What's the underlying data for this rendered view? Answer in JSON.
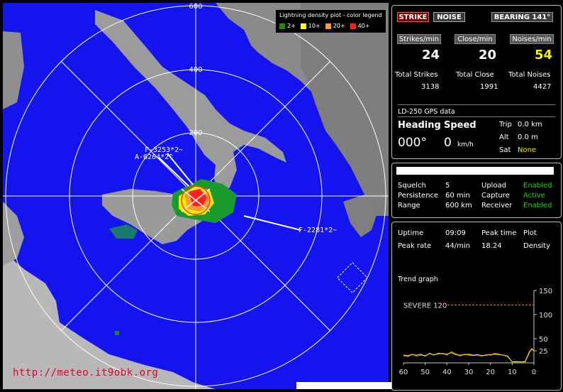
{
  "map": {
    "legend_title": "Lightning density plot - color legend",
    "legend": [
      {
        "label": "2+",
        "color": "#1a8a1a"
      },
      {
        "label": "10+",
        "color": "#ffff00"
      },
      {
        "label": "20+",
        "color": "#ff9a30"
      },
      {
        "label": "40+",
        "color": "#ff1e1e"
      }
    ],
    "rings": [
      "600",
      "400",
      "200"
    ],
    "url": "http://meteo.it9obk.org",
    "tags": {
      "overlap": "F-3253*2~",
      "a_tag": "A-6264*2^",
      "f_tag": "F-2281*2~"
    },
    "colors": {
      "sea": "#1414ee",
      "land": "#8c8c8c",
      "ring": "#ffffff"
    }
  },
  "top_panel": {
    "strike_btn": "STRIKE",
    "noise_btn": "NOISE",
    "bearing_btn": "BEARING 141°",
    "headers": [
      "Strikes/min",
      "Close/min",
      "Noises/min"
    ],
    "rates": [
      "24",
      "20",
      "54"
    ],
    "total_labels": [
      "Total Strikes",
      "Total Close",
      "Total Noises"
    ],
    "totals": [
      "3138",
      "1991",
      "4427"
    ],
    "gps_title": "LD-250 GPS data",
    "heading_label": "Heading",
    "speed_label": "Speed",
    "heading_value": "000°",
    "speed_value": "0",
    "speed_unit": "km/h",
    "trip_label": "Trip",
    "trip_value": "0.0 km",
    "alt_label": "Alt",
    "alt_value": "0.0 m",
    "sat_label": "Sat",
    "sat_value": "None"
  },
  "settings": {
    "squelch_label": "Squelch",
    "squelch_value": "5",
    "persistence_label": "Persistence",
    "persistence_value": "60 min",
    "range_label": "Range",
    "range_value": "600 km",
    "upload_label": "Upload",
    "upload_value": "Enabled",
    "capture_label": "Capture",
    "capture_value": "Active",
    "receiver_label": "Receiver",
    "receiver_value": "Enabled"
  },
  "stats": {
    "uptime_label": "Uptime",
    "uptime_value": "09:09",
    "peak_time_label": "Peak time",
    "peak_time_value": "18.24",
    "plot_label": "Plot",
    "plot_value": "Density",
    "peak_rate_label": "Peak rate",
    "peak_rate_value": "44/min",
    "trend_title": "Trend graph",
    "severe_label": "SEVERE 120"
  },
  "chart_data": {
    "type": "line",
    "title": "Trend graph",
    "x": [
      60,
      58,
      56,
      54,
      52,
      50,
      48,
      46,
      44,
      42,
      40,
      38,
      36,
      34,
      32,
      30,
      28,
      26,
      24,
      22,
      20,
      18,
      16,
      14,
      12,
      10,
      8,
      6,
      4,
      2,
      1,
      0
    ],
    "series": [
      {
        "values": [
          15,
          13,
          18,
          14,
          16,
          15,
          19,
          17,
          18,
          20,
          16,
          23,
          19,
          14,
          18,
          16,
          15,
          16,
          14,
          17,
          16,
          20,
          18,
          16,
          14,
          2,
          3,
          2,
          2,
          22,
          30,
          24
        ]
      },
      {
        "values": [
          16,
          15,
          17,
          16,
          18,
          14,
          20,
          16,
          20,
          19,
          18,
          21,
          17,
          16,
          17,
          18,
          16,
          17,
          15,
          16,
          17,
          18,
          17,
          16,
          13,
          2,
          2,
          2,
          3,
          24,
          28,
          26
        ]
      }
    ],
    "xlim": [
      60,
      0
    ],
    "ylim": [
      0,
      150
    ],
    "yticks": [
      25,
      50,
      100,
      150
    ],
    "xticks": [
      60,
      50,
      40,
      30,
      20,
      10,
      0
    ],
    "threshold": 120
  }
}
